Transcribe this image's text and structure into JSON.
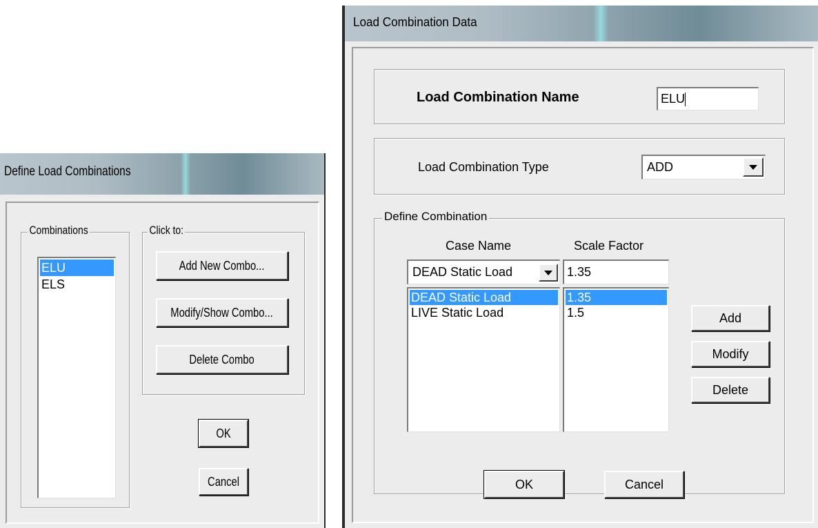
{
  "left_dialog": {
    "title": "Define Load Combinations",
    "combinations_legend": "Combinations",
    "combinations": [
      {
        "label": "ELU",
        "selected": true
      },
      {
        "label": "ELS",
        "selected": false
      }
    ],
    "clickto_legend": "Click to:",
    "add_new_label": "Add New Combo...",
    "modify_show_label": "Modify/Show Combo...",
    "delete_label": "Delete Combo",
    "ok_label": "OK",
    "cancel_label": "Cancel"
  },
  "right_dialog": {
    "title": "Load Combination Data",
    "name_label": "Load Combination Name",
    "name_value": "ELU",
    "type_label": "Load Combination Type",
    "type_value": "ADD",
    "define_legend": "Define Combination",
    "case_name_header": "Case Name",
    "scale_factor_header": "Scale Factor",
    "case_select_value": "DEAD Static Load",
    "scale_input_value": "1.35",
    "cases": [
      {
        "name": "DEAD Static Load",
        "factor": "1.35",
        "selected": true
      },
      {
        "name": "LIVE Static Load",
        "factor": "1.5",
        "selected": false
      }
    ],
    "add_label": "Add",
    "modify_label": "Modify",
    "delete_label": "Delete",
    "ok_label": "OK",
    "cancel_label": "Cancel"
  },
  "colors": {
    "selection": "#3399ff",
    "dialog_bg": "#ececec"
  }
}
